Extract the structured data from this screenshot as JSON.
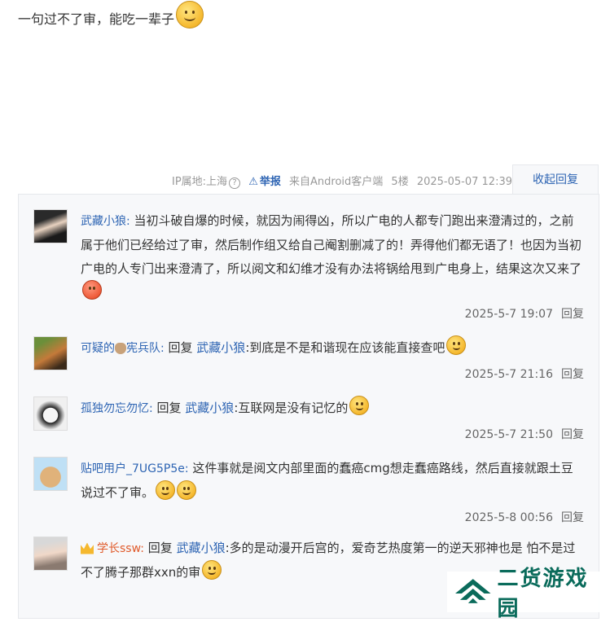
{
  "post": {
    "text": "一句过不了审，能吃一辈子"
  },
  "meta": {
    "ip_label": "IP属地:上海",
    "report_label": "举报",
    "client_label": "来自Android客户端",
    "floor": "5楼",
    "datetime": "2025-05-07 12:39",
    "collapse_label": "收起回复"
  },
  "replies": [
    {
      "user": "武藏小狼:",
      "content": "当初斗破自爆的时候，就因为闹得凶，所以广电的人都专门跑出来澄清过的，之前属于他们已经给过了审，然后制作组又给自己阉割删减了的！弄得他们都无语了！也因为当初广电的人专门出来澄清了，所以阅文和幻维才没有办法将锅给甩到广电身上，结果这次又来了",
      "time": "2025-5-7 19:07",
      "reply_label": "回复"
    },
    {
      "user": "可疑的",
      "user_suffix": "宪兵队:",
      "reply_word": "回复",
      "target": "武藏小狼",
      "content": ":到底是不是和谐现在应该能直接查吧",
      "time": "2025-5-7 21:16",
      "reply_label": "回复"
    },
    {
      "user": "孤独勿忘勿忆:",
      "reply_word": "回复",
      "target": "武藏小狼",
      "content": ":互联网是没有记忆的",
      "time": "2025-5-7 21:50",
      "reply_label": "回复"
    },
    {
      "user": "贴吧用户_7UG5P5e:",
      "content": "这件事就是阅文内部里面的蠢癌cmg想走蠢癌路线，然后直接就跟土豆说过不了审。",
      "time": "2025-5-8 00:56",
      "reply_label": "回复"
    },
    {
      "user": "学长ssw:",
      "reply_word": "回复",
      "target": "武藏小狼",
      "content": ":多的是动漫开后宫的，爱奇艺热度第一的逆天邪神也是 怕不是过不了腾子那群xxn的审"
    }
  ],
  "watermark": {
    "text": "二货游戏园"
  }
}
